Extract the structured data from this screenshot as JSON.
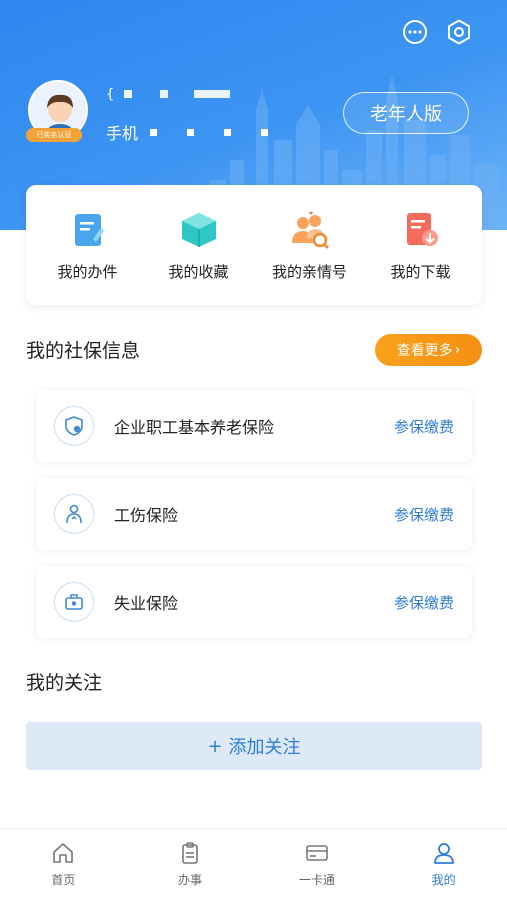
{
  "header": {
    "elder_mode_label": "老年人版",
    "phone_prefix": "手机",
    "name_prefix": "{",
    "avatar_badge": "已实名认证",
    "icons": [
      "message-icon",
      "settings-icon"
    ]
  },
  "quick_actions": [
    {
      "label": "我的办件",
      "icon": "document-edit-icon"
    },
    {
      "label": "我的收藏",
      "icon": "box-icon"
    },
    {
      "label": "我的亲情号",
      "icon": "family-search-icon"
    },
    {
      "label": "我的下载",
      "icon": "download-icon"
    }
  ],
  "social_insurance": {
    "title": "我的社保信息",
    "more_label": "查看更多",
    "items": [
      {
        "name": "企业职工基本养老保险",
        "action": "参保缴费",
        "icon": "pension-shield-icon"
      },
      {
        "name": "工伤保险",
        "action": "参保缴费",
        "icon": "injury-person-icon"
      },
      {
        "name": "失业保险",
        "action": "参保缴费",
        "icon": "unemployment-bag-icon"
      }
    ]
  },
  "follow": {
    "title": "我的关注",
    "add_label": "添加关注"
  },
  "tabbar": [
    {
      "label": "首页",
      "icon": "home-icon",
      "active": false
    },
    {
      "label": "办事",
      "icon": "clipboard-icon",
      "active": false
    },
    {
      "label": "一卡通",
      "icon": "card-icon",
      "active": false
    },
    {
      "label": "我的",
      "icon": "user-icon",
      "active": true
    }
  ],
  "colors": {
    "primary": "#2c7ed6",
    "header_blue": "#2f86f0",
    "orange": "#f68f13"
  }
}
